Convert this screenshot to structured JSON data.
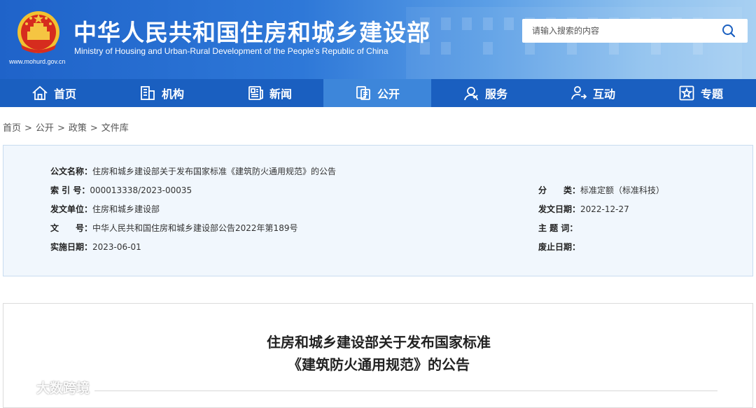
{
  "header": {
    "title_cn": "中华人民共和国住房和城乡建设部",
    "title_en": "Ministry of Housing and Urban-Rural Development of the People's Republic of China",
    "site_url": "www.mohurd.gov.cn",
    "search_placeholder": "请输入搜索的内容",
    "emblem_icon": "national-emblem-icon"
  },
  "nav": {
    "items": [
      {
        "label": "首页",
        "icon": "home-icon"
      },
      {
        "label": "机构",
        "icon": "building-icon"
      },
      {
        "label": "新闻",
        "icon": "newspaper-icon"
      },
      {
        "label": "公开",
        "icon": "document-icon"
      },
      {
        "label": "服务",
        "icon": "service-icon"
      },
      {
        "label": "互动",
        "icon": "interaction-icon"
      },
      {
        "label": "专题",
        "icon": "star-icon"
      }
    ],
    "active_label": "公开"
  },
  "breadcrumb": {
    "items": [
      "首页",
      "公开",
      "政策",
      "文件库"
    ],
    "separator": ">"
  },
  "meta": {
    "doc_name_label": "公文名称：",
    "doc_name": "住房和城乡建设部关于发布国家标准《建筑防火通用规范》的公告",
    "index_label": "索 引 号：",
    "index_no": "000013338/2023-00035",
    "category_label": "分　　类：",
    "category": "标准定额（标准科技）",
    "issuer_label": "发文单位：",
    "issuer": "住房和城乡建设部",
    "issue_date_label": "发文日期：",
    "issue_date": "2022-12-27",
    "doc_no_label": "文　　号：",
    "doc_no": "中华人民共和国住房和城乡建设部公告2022年第189号",
    "keywords_label": "主 题 词：",
    "keywords": "",
    "effective_label": "实施日期：",
    "effective_date": "2023-06-01",
    "repeal_label": "废止日期：",
    "repeal_date": ""
  },
  "article": {
    "title_line1": "住房和城乡建设部关于发布国家标准",
    "title_line2": "《建筑防火通用规范》的公告"
  },
  "watermark": {
    "text": "大数跨境",
    "icon": "watermark-logo-icon"
  },
  "colors": {
    "nav_bg": "#1a5fc0",
    "nav_active": "#3d86da",
    "header_start": "#1f63c9",
    "header_end": "#a8d0f2",
    "meta_bg": "#f1f7fd"
  }
}
